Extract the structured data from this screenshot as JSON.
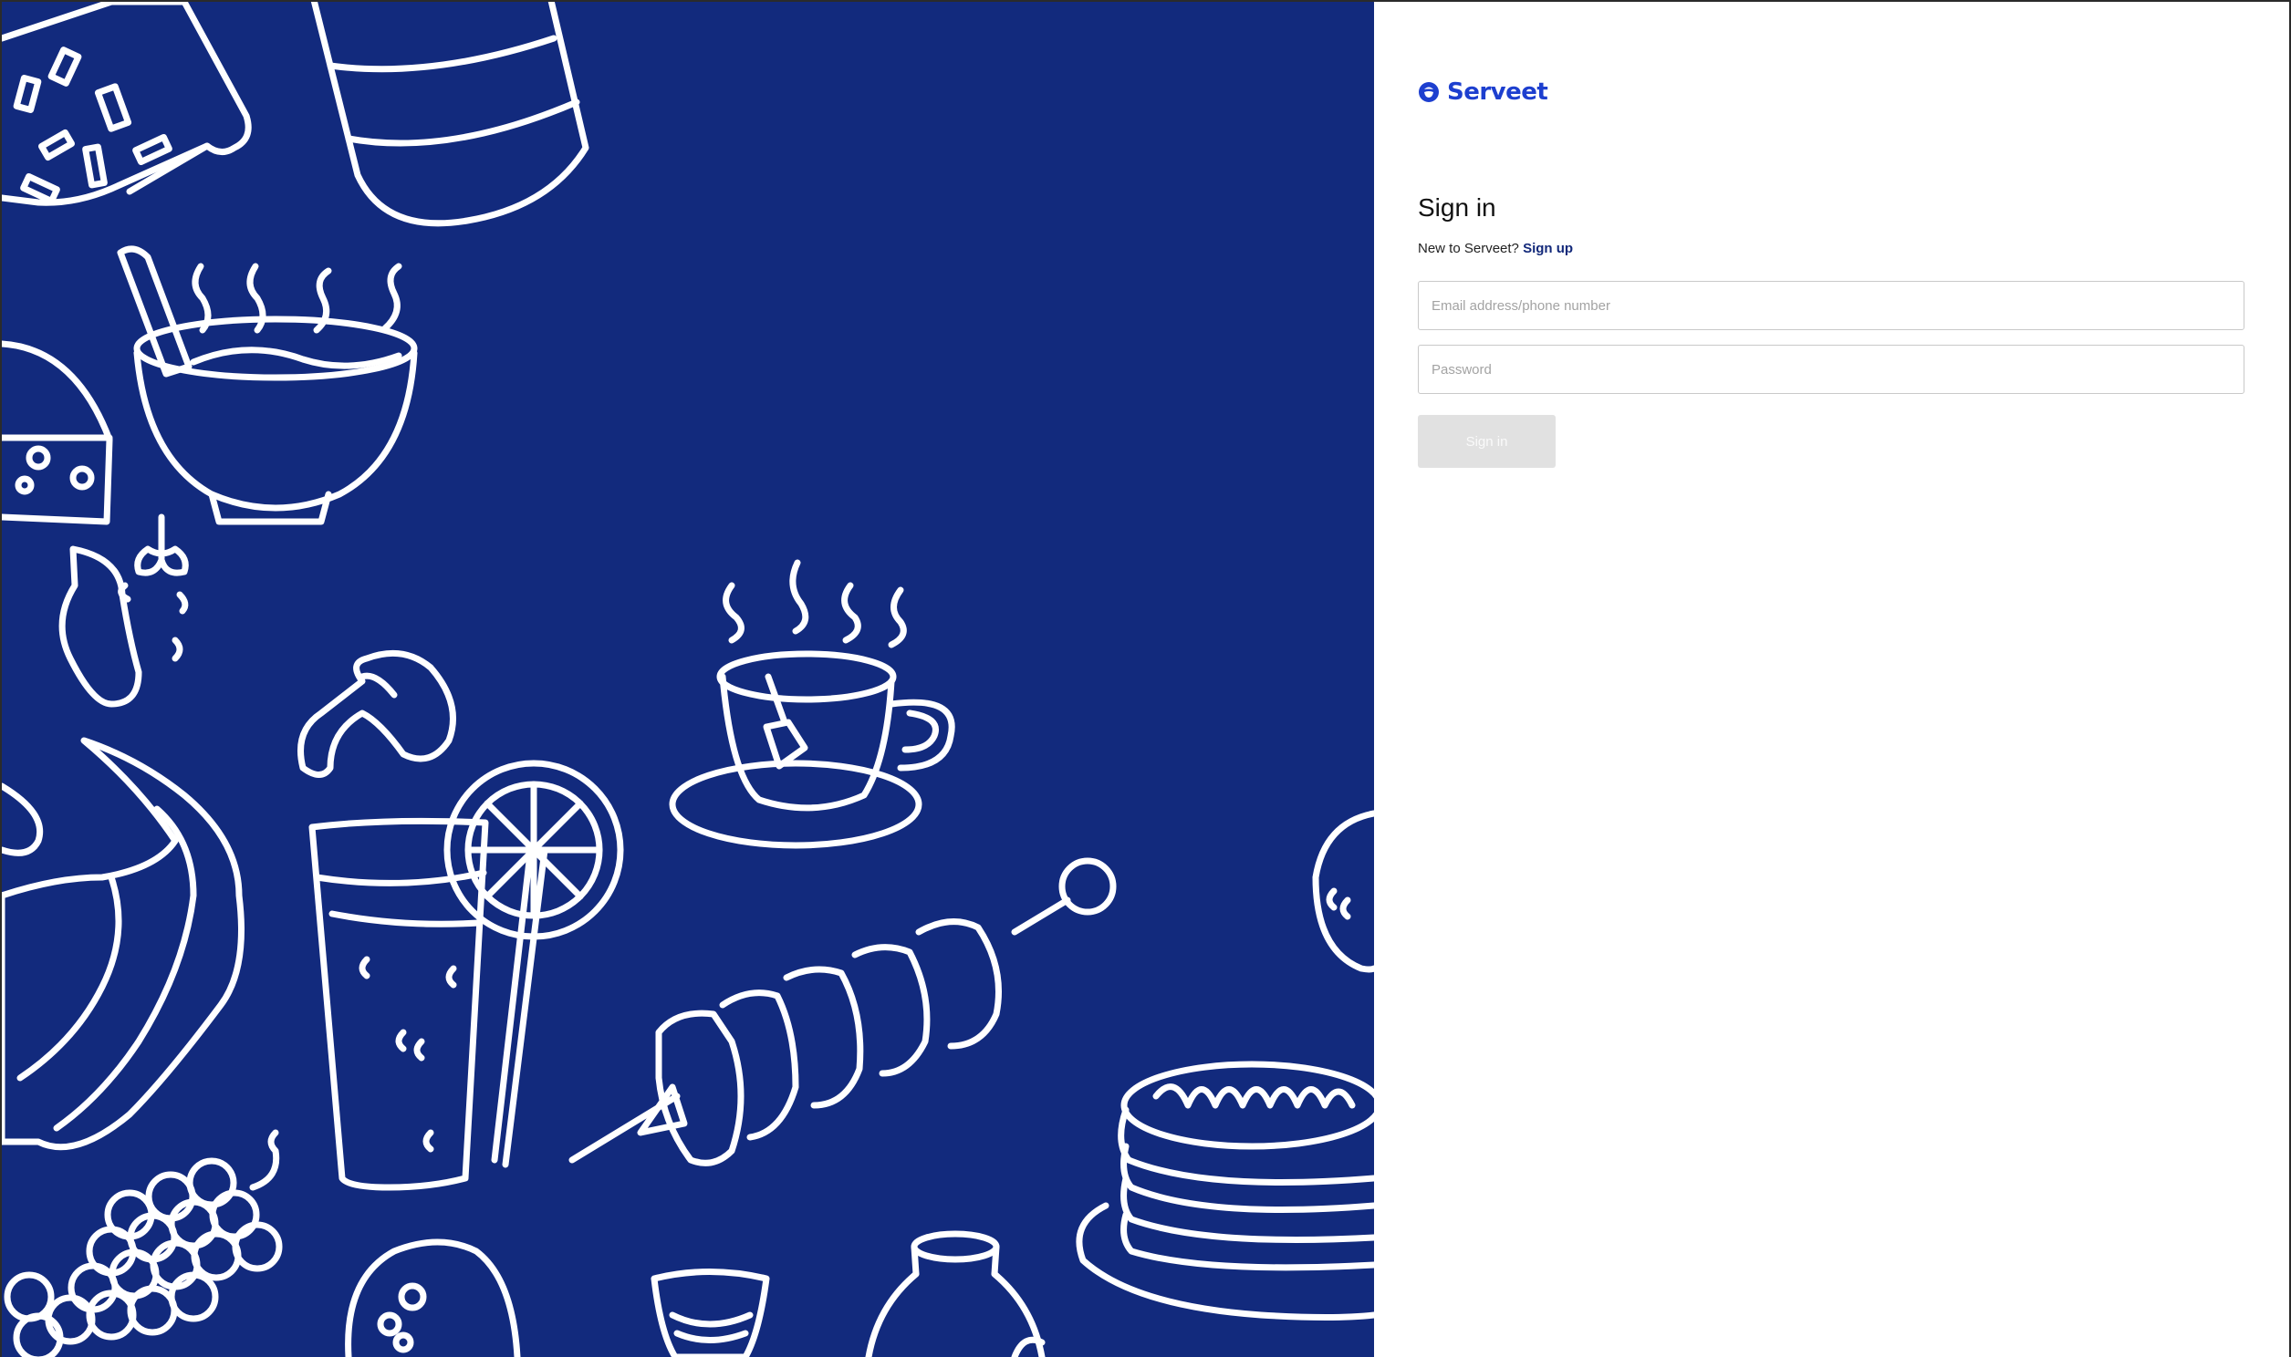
{
  "brand": {
    "name": "Serveet",
    "color": "#1d3fcf",
    "icon": "serveet-logo-icon"
  },
  "signin": {
    "title": "Sign in",
    "prompt": "New to Serveet?",
    "signup_link": "Sign up",
    "email_placeholder": "Email address/phone number",
    "password_placeholder": "Password",
    "button_label": "Sign in"
  },
  "illustration": {
    "background_color": "#122a7d",
    "line_color": "#ffffff",
    "items": [
      "pizza-slice",
      "bottle",
      "soup-bowl",
      "cheese",
      "strawberry",
      "mushroom",
      "tea-cup",
      "croissant",
      "lemonade-glass",
      "kebab-skewer",
      "grapes",
      "pancake-stack",
      "bun",
      "shot-glass",
      "jar"
    ]
  }
}
